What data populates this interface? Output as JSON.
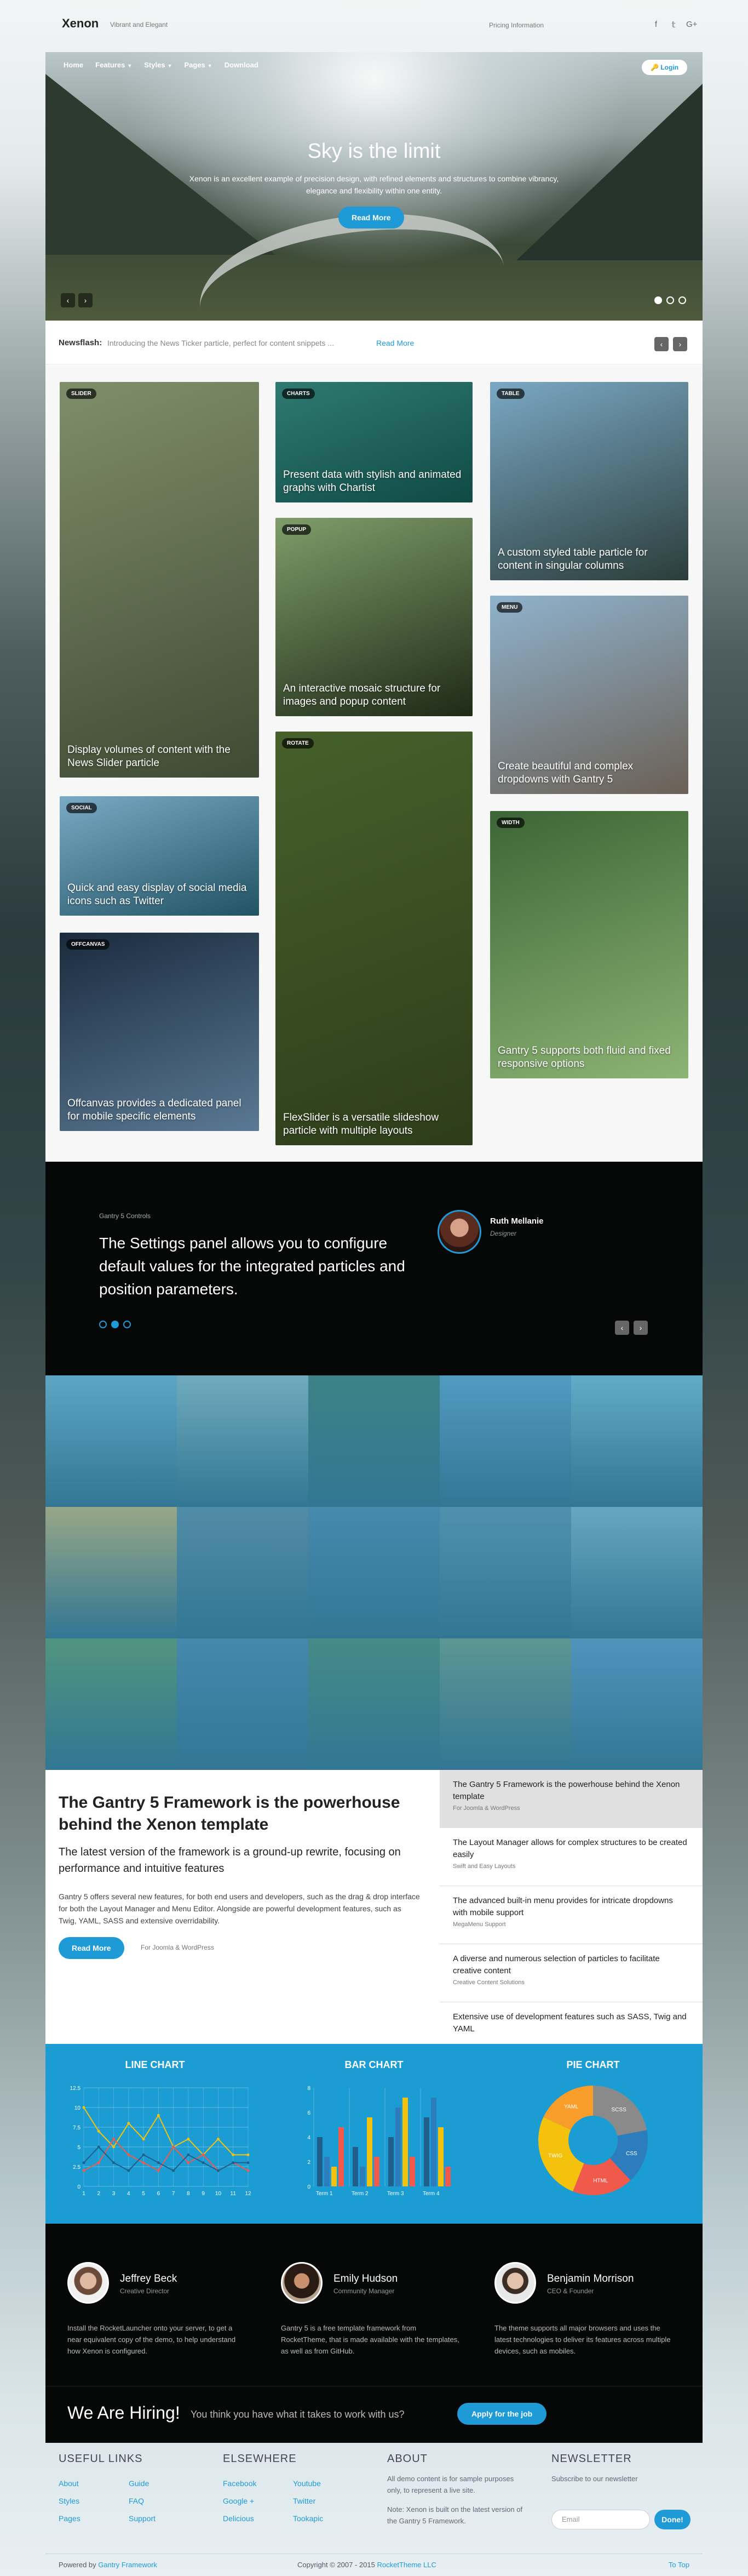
{
  "header": {
    "logo": "Xenon",
    "tagline": "Vibrant and Elegant",
    "pricing": "Pricing Information",
    "social": [
      "facebook-icon",
      "twitter-icon",
      "google-plus-icon"
    ]
  },
  "nav": {
    "items": [
      "Home",
      "Features",
      "Styles",
      "Pages",
      "Download"
    ],
    "dropdown": [
      false,
      true,
      true,
      true,
      false
    ],
    "login": "Login"
  },
  "hero": {
    "title": "Sky is the limit",
    "text": "Xenon is an excellent example of precision design, with refined elements and structures to combine vibrancy, elegance and flexibility within one entity.",
    "button": "Read More",
    "prev": "‹",
    "next": "›"
  },
  "newsflash": {
    "label": "Newsflash:",
    "text": "Introducing the News Ticker particle, perfect for content snippets ...",
    "more": "Read More"
  },
  "tiles": [
    {
      "tag": "SLIDER",
      "caption": "Display volumes of content with the News Slider particle",
      "colors": [
        "#7f8e6a",
        "#3f4a33"
      ]
    },
    {
      "tag": "CHARTS",
      "caption": "Present data with stylish and animated graphs with Chartist",
      "colors": [
        "#2e7a72",
        "#104a45"
      ]
    },
    {
      "tag": "TABLE",
      "caption": "A custom styled table particle for content in singular columns",
      "colors": [
        "#7aa8c4",
        "#2b3d3a"
      ]
    },
    {
      "tag": "POPUP",
      "caption": "An interactive mosaic structure for images and popup content",
      "colors": [
        "#7f9d6a",
        "#1e2a17"
      ]
    },
    {
      "tag": "MENU",
      "caption": "Create beautiful and complex dropdowns with Gantry 5",
      "colors": [
        "#8fb2cc",
        "#6b6055"
      ]
    },
    {
      "tag": "SOCIAL",
      "caption": "Quick and easy display of social media icons such as Twitter",
      "colors": [
        "#7aaac4",
        "#215365"
      ]
    },
    {
      "tag": "ROTATE",
      "caption": "FlexSlider is a versatile slideshow particle with multiple layouts",
      "colors": [
        "#46602a",
        "#2d3d1a"
      ]
    },
    {
      "tag": "WIDTH",
      "caption": "Gantry 5 supports both fluid and fixed responsive options",
      "colors": [
        "#3c6536",
        "#8db474"
      ]
    },
    {
      "tag": "OFFCANVAS",
      "caption": "Offcanvas provides a dedicated panel for mobile specific elements",
      "colors": [
        "#1a2b3d",
        "#5a7994"
      ]
    }
  ],
  "testimonial": {
    "small": "Gantry 5 Controls",
    "quote": "The Settings panel allows you to configure default values for the integrated particles and position parameters.",
    "name": "Ruth Mellanie",
    "role": "Designer"
  },
  "gallery": {
    "colors": [
      "#7fb5c8",
      "#9bbcbd",
      "#4f7d6a",
      "#6fa2c3",
      "#87bccb",
      "#d9b56a",
      "#6d8c9a",
      "#5c8aa6",
      "#6c93a6",
      "#8fb4c3",
      "#6c9a5e",
      "#5a87a6",
      "#5d8a6a",
      "#7f9d7d",
      "#6c98bc"
    ]
  },
  "content": {
    "title": "The Gantry 5 Framework is the powerhouse behind the Xenon template",
    "lead": "The latest version of the framework is a ground-up rewrite, focusing on performance and intuitive features",
    "body": "Gantry 5 offers several new features, for both end users and developers, such as the drag & drop interface for both the Layout Manager and Menu Editor. Alongside are powerful development features, such as Twig, YAML, SASS and extensive overridability.",
    "button": "Read More",
    "meta": "For Joomla & WordPress",
    "side": [
      {
        "title": "The Gantry 5 Framework is the powerhouse behind the Xenon template",
        "sub": "For Joomla & WordPress"
      },
      {
        "title": "The Layout Manager allows for complex structures to be created easily",
        "sub": "Swift and Easy Layouts"
      },
      {
        "title": "The advanced built-in menu provides for intricate dropdowns with mobile support",
        "sub": "MegaMenu Support"
      },
      {
        "title": "A diverse and numerous selection of particles to facilitate creative content",
        "sub": "Creative Content Solutions"
      },
      {
        "title": "Extensive use of development features such as SASS, Twig and YAML",
        "sub": ""
      }
    ]
  },
  "chart_data": [
    {
      "type": "line",
      "title": "LINE CHART",
      "x": [
        1,
        2,
        3,
        4,
        5,
        6,
        7,
        8,
        9,
        10,
        11,
        12
      ],
      "ylim": [
        0,
        12.5
      ],
      "yticks": [
        "12.5",
        "10",
        "7.5",
        "5",
        "2.5",
        "0"
      ],
      "series": [
        {
          "values": [
            10,
            7,
            5,
            8,
            6,
            9,
            5,
            6,
            4,
            6,
            4,
            4
          ]
        },
        {
          "values": [
            2,
            3,
            6,
            4,
            3,
            2,
            5,
            3,
            4,
            2,
            3,
            2
          ]
        },
        {
          "values": [
            3,
            5,
            3,
            2,
            4,
            3,
            2,
            4,
            3,
            2,
            3,
            3
          ]
        }
      ]
    },
    {
      "type": "bar",
      "title": "BAR CHART",
      "categories": [
        "Term 1",
        "Term 2",
        "Term 3",
        "Term 4"
      ],
      "ylim": [
        0,
        10
      ],
      "yticks": [
        "8",
        "6",
        "4",
        "2",
        "0"
      ],
      "series": [
        {
          "values": [
            5,
            4,
            5,
            7
          ]
        },
        {
          "values": [
            3,
            2,
            8,
            9
          ]
        },
        {
          "values": [
            2,
            7,
            9,
            6
          ]
        },
        {
          "values": [
            6,
            3,
            3,
            2
          ]
        }
      ]
    },
    {
      "type": "pie",
      "title": "PIE CHART",
      "labels": [
        "SCSS",
        "CSS",
        "HTML",
        "TWIG",
        "YAML"
      ],
      "values": [
        22,
        16,
        18,
        26,
        18
      ]
    }
  ],
  "team": [
    {
      "name": "Jeffrey Beck",
      "role": "Creative Director",
      "desc": "Install the RocketLauncher onto your server, to get a near equivalent copy of the demo, to help understand how Xenon is configured."
    },
    {
      "name": "Emily Hudson",
      "role": "Community Manager",
      "desc": "Gantry 5 is a free template framework from RocketTheme, that is made available with the templates, as well as from GitHub."
    },
    {
      "name": "Benjamin Morrison",
      "role": "CEO & Founder",
      "desc": "The theme supports all major browsers and uses the latest technologies to deliver its features across multiple devices, such as mobiles."
    }
  ],
  "hiring": {
    "title": "We Are Hiring!",
    "text": "You think you have what it takes to work with us?",
    "button": "Apply for the job"
  },
  "footer": {
    "useful": {
      "title": "USEFUL LINKS",
      "col1": [
        "About",
        "Styles",
        "Pages"
      ],
      "col2": [
        "Guide",
        "FAQ",
        "Support"
      ]
    },
    "elsewhere": {
      "title": "ELSEWHERE",
      "col1": [
        "Facebook",
        "Google +",
        "Delicious"
      ],
      "col2": [
        "Youtube",
        "Twitter",
        "Tookapic"
      ]
    },
    "about": {
      "title": "ABOUT",
      "text1": "All demo content is for sample purposes only, to represent a live site.",
      "text2": "Note: Xenon is built on the latest version of the Gantry 5 Framework."
    },
    "newsletter": {
      "title": "NEWSLETTER",
      "text": "Subscribe to our newsletter",
      "placeholder": "Email",
      "button": "Done!"
    },
    "powered_prefix": "Powered by",
    "powered_link": "Gantry Framework",
    "copyright": "Copyright © 2007 - 2015",
    "copyright_link": "RocketTheme LLC",
    "totop": "To Top"
  },
  "colors": {
    "accent": "#1e9bd7",
    "dark": "#060707"
  }
}
